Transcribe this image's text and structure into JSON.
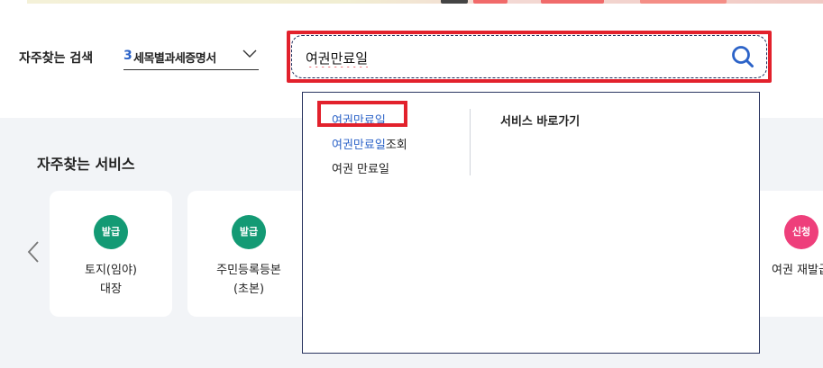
{
  "frequent_search": {
    "label": "자주찾는 검색",
    "category_number": "3",
    "category_text": "세목별과세증명서"
  },
  "search": {
    "value": "여권만료일",
    "icon": "search-icon"
  },
  "autocomplete": {
    "suggestions": [
      {
        "highlight": "여권만료일",
        "rest": ""
      },
      {
        "highlight": "여권만료일",
        "rest": "조회"
      },
      {
        "highlight": "",
        "rest": "여권 만료일"
      }
    ],
    "shortcut_title": "서비스 바로가기"
  },
  "services": {
    "title": "자주찾는 서비스",
    "cards": [
      {
        "badge": "발급",
        "name": "토지(임야)\n대장"
      },
      {
        "badge": "발급",
        "name": "주민등록등본\n(초본)"
      },
      {
        "badge": "신청",
        "name": "여권 재발급"
      }
    ]
  },
  "colors": {
    "accent_blue": "#2c63c8",
    "badge_green": "#139a74",
    "badge_pink": "#ee3f7b",
    "highlight_red": "#e2212c"
  }
}
